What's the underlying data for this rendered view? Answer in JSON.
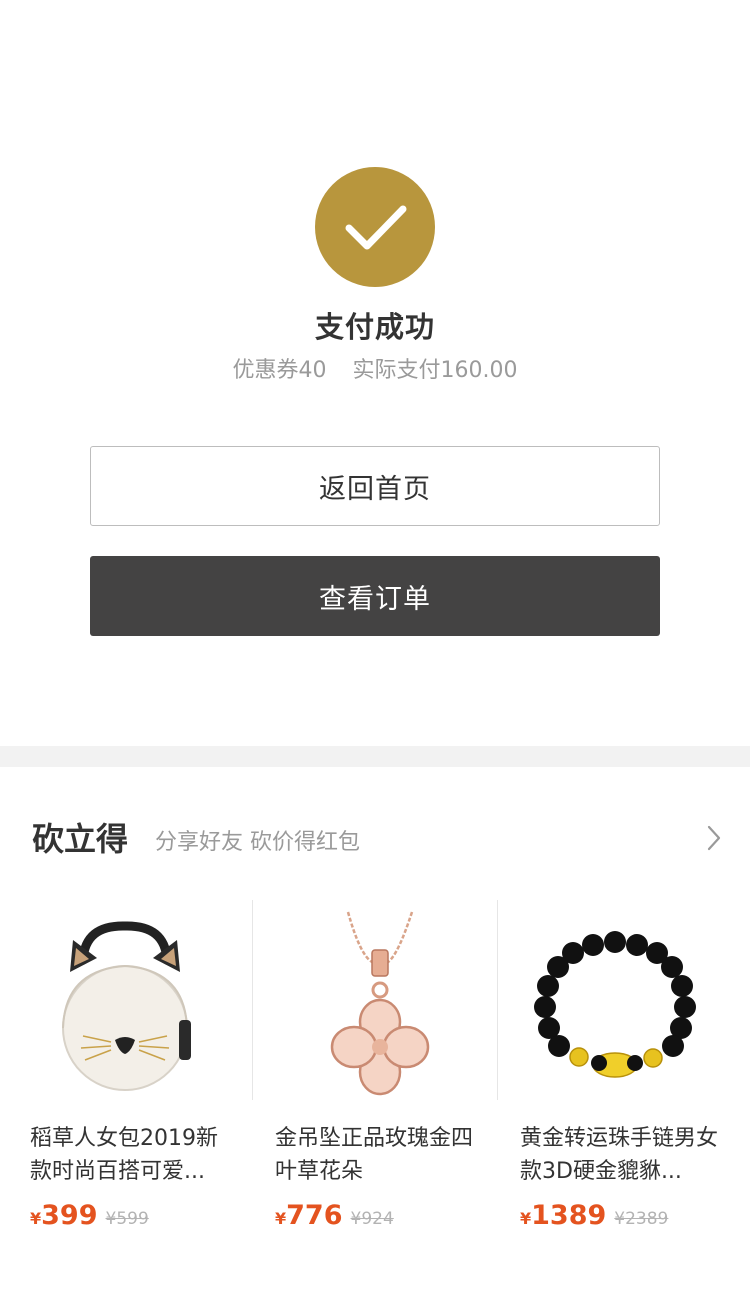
{
  "result": {
    "title": "支付成功",
    "coupon": "优惠券40",
    "actual_paid": "实际支付160.00"
  },
  "buttons": {
    "home_label": "返回首页",
    "order_label": "查看订单"
  },
  "bargain": {
    "title": "砍立得",
    "subtitle": "分享好友 砍价得红包",
    "more_icon": "chevron-right-icon",
    "products": [
      {
        "name": "稻草人女包2019新款时尚百搭可爱...",
        "currency": "¥",
        "price": "399",
        "original_price": "¥599",
        "image": "handbag-image"
      },
      {
        "name": "金吊坠正品玫瑰金四叶草花朵",
        "currency": "¥",
        "price": "776",
        "original_price": "¥924",
        "image": "pendant-necklace-image"
      },
      {
        "name": "黄金转运珠手链男女款3D硬金貔貅...",
        "currency": "¥",
        "price": "1389",
        "original_price": "¥2389",
        "image": "bead-bracelet-image"
      }
    ]
  },
  "colors": {
    "accent_gold": "#b8963d",
    "price_red": "#e4531f",
    "dark_button": "#444343"
  }
}
